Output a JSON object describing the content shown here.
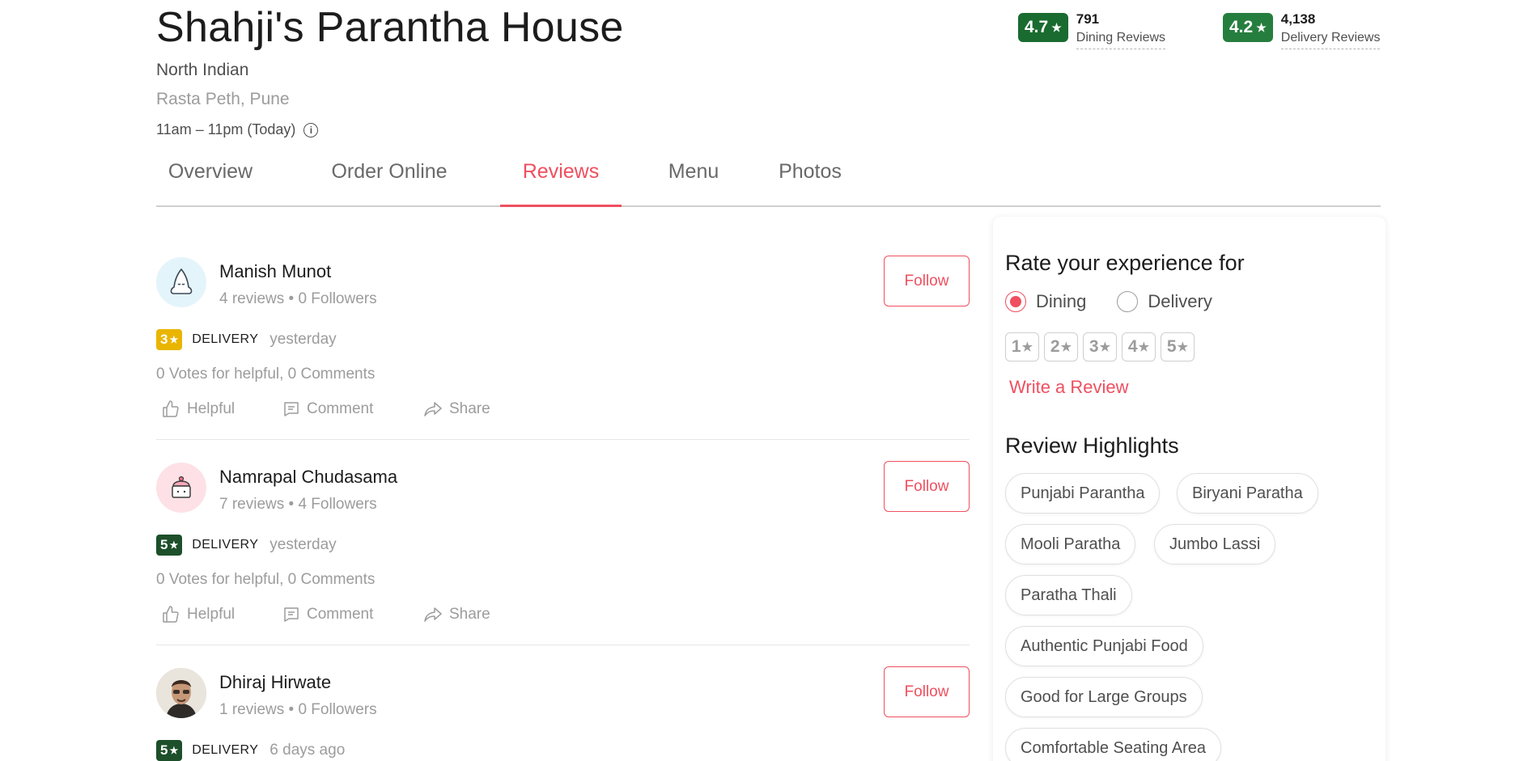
{
  "restaurant": {
    "name": "Shahji's Parantha House",
    "cuisine": "North Indian",
    "locality": "Rasta Peth, Pune",
    "timing": "11am – 11pm (Today)"
  },
  "ratings": [
    {
      "value": "4.7",
      "count": "791",
      "label": "Dining Reviews",
      "color": "#1a6b30"
    },
    {
      "value": "4.2",
      "count": "4,138",
      "label": "Delivery Reviews",
      "color": "#267e3e"
    }
  ],
  "tabs": [
    {
      "label": "Overview"
    },
    {
      "label": "Order Online"
    },
    {
      "label": "Reviews",
      "active": true
    },
    {
      "label": "Menu"
    },
    {
      "label": "Photos"
    }
  ],
  "reviews": [
    {
      "name": "Manish Munot",
      "meta": "4 reviews • 0 Followers",
      "follow": "Follow",
      "rating": "3",
      "rating_color": "#e9b500",
      "type": "DELIVERY",
      "time": "yesterday",
      "votes": "0 Votes for helpful, 0 Comments",
      "avatar_icon": "ghost-icon"
    },
    {
      "name": "Namrapal Chudasama",
      "meta": "7 reviews • 4 Followers",
      "follow": "Follow",
      "rating": "5",
      "rating_color": "#1c4f2a",
      "type": "DELIVERY",
      "time": "yesterday",
      "votes": "0 Votes for helpful, 0 Comments",
      "avatar_icon": "cupcake-icon"
    },
    {
      "name": "Dhiraj Hirwate",
      "meta": "1 reviews • 0 Followers",
      "follow": "Follow",
      "rating": "5",
      "rating_color": "#1c4f2a",
      "type": "DELIVERY",
      "time": "6 days ago",
      "avatar_icon": "user-photo-icon"
    }
  ],
  "actions": {
    "helpful": "Helpful",
    "comment": "Comment",
    "share": "Share"
  },
  "sidebar": {
    "rate_title": "Rate your experience for",
    "options": [
      "Dining",
      "Delivery"
    ],
    "selected": "Dining",
    "stars": [
      "1",
      "2",
      "3",
      "4",
      "5"
    ],
    "write_review": "Write a Review",
    "highlights_title": "Review Highlights",
    "highlights": [
      "Punjabi Parantha",
      "Biryani Paratha",
      "Mooli Paratha",
      "Jumbo Lassi",
      "Paratha Thali",
      "Authentic Punjabi Food",
      "Good for Large Groups",
      "Comfortable Seating Area"
    ]
  },
  "colors": {
    "accent": "#ef4f5f",
    "star": "★"
  }
}
